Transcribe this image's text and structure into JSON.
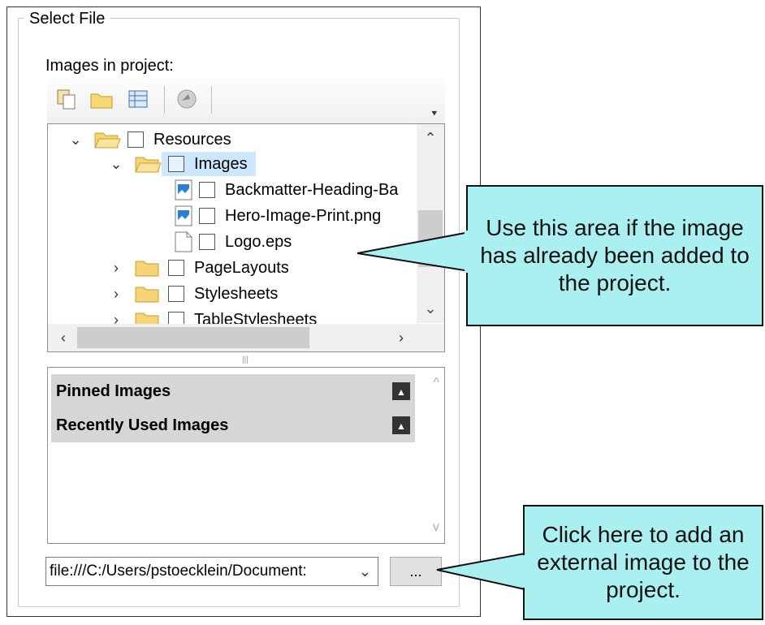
{
  "group_title": "Select File",
  "images_label": "Images in project:",
  "tree": {
    "items": [
      {
        "label": "Resources"
      },
      {
        "label": "Images"
      },
      {
        "label": "Backmatter-Heading-Ba"
      },
      {
        "label": "Hero-Image-Print.png"
      },
      {
        "label": "Logo.eps"
      },
      {
        "label": "PageLayouts"
      },
      {
        "label": "Stylesheets"
      },
      {
        "label": "TableStylesheets"
      }
    ]
  },
  "sections": [
    {
      "label": "Pinned Images"
    },
    {
      "label": "Recently Used Images"
    }
  ],
  "path_value": "file:///C:/Users/pstoecklein/Document:",
  "browse_label": "...",
  "callouts": [
    {
      "text": "Use this area if the image has already been added to the project."
    },
    {
      "text": "Click here to add an external image to the project."
    }
  ],
  "colors": {
    "callout_fill": "#aaf0f0",
    "selection": "#cce8ff"
  }
}
